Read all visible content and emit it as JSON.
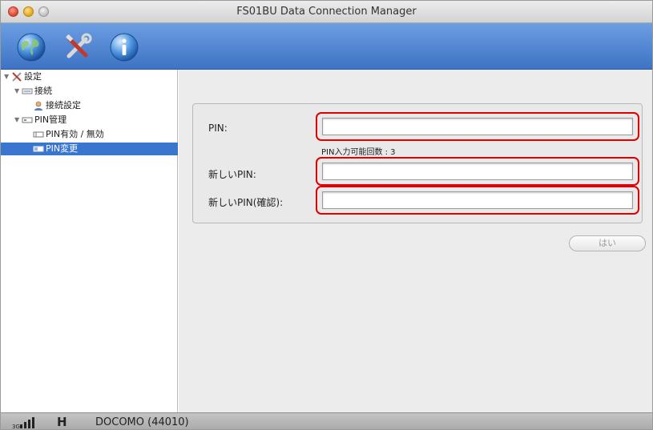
{
  "window": {
    "title": "FS01BU Data Connection Manager"
  },
  "toolbar": {
    "buttons": [
      {
        "icon": "globe-icon"
      },
      {
        "icon": "tools-icon"
      },
      {
        "icon": "info-icon"
      }
    ]
  },
  "sidebar": {
    "items": [
      {
        "label": "設定",
        "icon": "tools-icon",
        "expanded": true
      },
      {
        "label": "接続",
        "icon": "connection-icon",
        "expanded": true
      },
      {
        "label": "接続設定",
        "icon": "user-icon"
      },
      {
        "label": "PIN管理",
        "icon": "sim-card-icon",
        "expanded": true
      },
      {
        "label": "PIN有効 / 無効",
        "icon": "sim-card-icon"
      },
      {
        "label": "PIN変更",
        "icon": "sim-card-icon",
        "selected": true
      }
    ]
  },
  "form": {
    "pin_label": "PIN:",
    "pin_value": "",
    "pin_remaining_label": "PIN入力可能回数 : 3",
    "new_pin_label": "新しいPIN:",
    "new_pin_value": "",
    "confirm_pin_label": "新しいPIN(確認):",
    "confirm_pin_value": "",
    "ok_button": "はい"
  },
  "status": {
    "signal_prefix": "3G",
    "network_type": "H",
    "carrier": "DOCOMO (44010)"
  },
  "colors": {
    "toolbar": "#4a82d4",
    "selection": "#3a75cf",
    "highlight_outline": "#e00000"
  }
}
